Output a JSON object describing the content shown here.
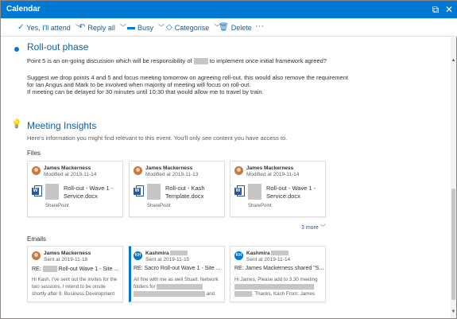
{
  "window": {
    "title": "Calendar"
  },
  "toolbar": {
    "attend_label": "Yes, I'll attend",
    "reply_label": "Reply all",
    "busy_label": "Busy",
    "categorise_label": "Categorise",
    "delete_label": "Delete",
    "more_label": "···"
  },
  "phase": {
    "title": "Roll-out phase",
    "line1_a": "Point 5 is an on-going discussion which will be responsibility of",
    "line1_b": "to implement once initial framework agreed?",
    "line2": "Suggest we drop points 4 and 5 and focus meeting tomorrow on agreeing roll-out, this would also remove the requirement",
    "line3": "for Ian Angus and Mark to be involved when majority of meeting will focus on roll-out.",
    "line4": "If meeting can be delayed for 30 minutes until 10:30 that would allow me to travel by train."
  },
  "insights": {
    "title": "Meeting Insights",
    "subtitle": "Here's information you might find relevant to this event. You'll only see content you have access to.",
    "files_label": "Files",
    "emails_label": "Emails",
    "more_files": "3 more",
    "files": [
      {
        "author": "James Mackerness",
        "meta": "Modified at 2019-11-14",
        "line1": "Roll-out - Wave 1 -",
        "line2": "Service.docx",
        "source": "SharePoint"
      },
      {
        "author": "James Mackerness",
        "meta": "Modified at 2019-11-13",
        "line1": "Roll-out - Kash",
        "line2": "Template.docx",
        "source": "SharePoint"
      },
      {
        "author": "James Mackerness",
        "meta": "Modified at 2019-11-14",
        "line1": "Roll-out - Wave 1 -",
        "line2": "Service.docx",
        "source": "SharePoint"
      }
    ],
    "emails": [
      {
        "author": "James Mackerness",
        "meta": "Sent at 2019-11-18",
        "subject_a": "RE:",
        "subject_b": "Roll-out Wave 1 - Site ...",
        "body1": "Hi Kash, I've sent out the invites for the",
        "body2": "two sessions. I intend to be onsite",
        "body3": "shortly after 9. Business Development"
      },
      {
        "author": "Kashmira",
        "initials": "KH",
        "meta": "Sent at 2019-11-15",
        "subject_a": "RE: Sacro Roll-out Wave 1 - Site ...",
        "body1": "All fine with me as well Stuart. Network",
        "body2": "folders for",
        "body3": "and"
      },
      {
        "author": "Kashmira",
        "initials": "KH",
        "meta": "Sent at 2019-11-14",
        "subject_a": "RE: James Mackerness shared \"S...",
        "body1": "Hi James, Please add to 3.30 meeting",
        "body2": "",
        "body3": ". Thanks, Kash From: James"
      }
    ]
  }
}
